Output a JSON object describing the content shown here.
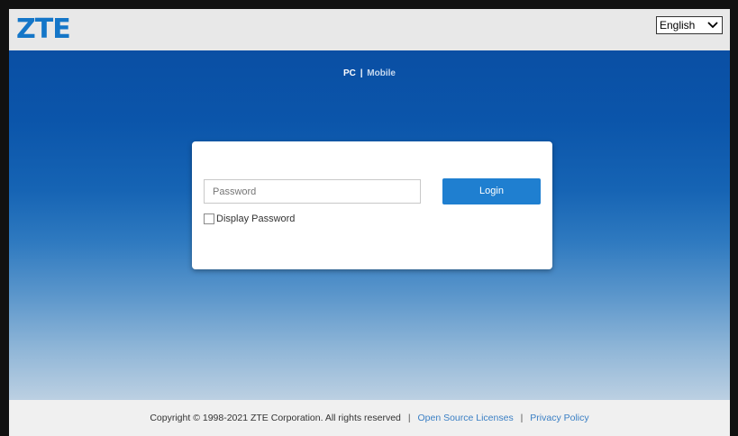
{
  "header": {
    "logo_text": "ZTE",
    "language_selected": "English"
  },
  "mode_switch": {
    "pc_label": "PC",
    "separator": "|",
    "mobile_label": "Mobile"
  },
  "login_form": {
    "password_placeholder": "Password",
    "login_label": "Login",
    "display_password_label": "Display Password"
  },
  "footer": {
    "copyright": "Copyright © 1998-2021 ZTE Corporation. All rights reserved",
    "separator": "|",
    "open_source_label": "Open Source Licenses",
    "privacy_label": "Privacy Policy"
  },
  "colors": {
    "brand": "#1476c8",
    "button": "#1f7fd0",
    "link": "#3a7fc4"
  }
}
